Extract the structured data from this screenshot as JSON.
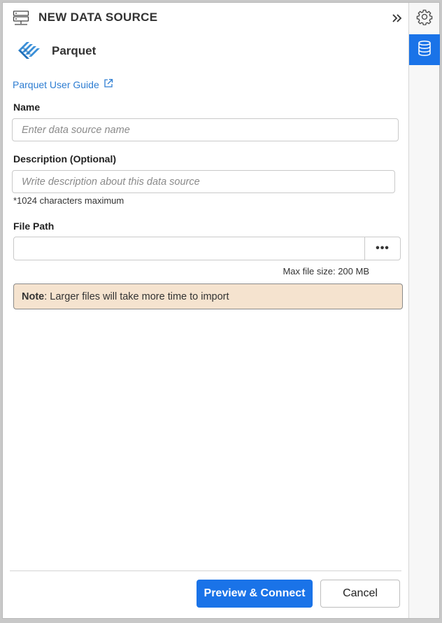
{
  "header": {
    "title": "NEW DATA SOURCE",
    "icon": "server-icon",
    "collapse_icon": "double-chevron-right-icon"
  },
  "source": {
    "name": "Parquet",
    "logo": "parquet-logo"
  },
  "guide": {
    "label": "Parquet User Guide",
    "icon": "external-link-icon"
  },
  "form": {
    "name_label": "Name",
    "name_placeholder": "Enter data source name",
    "name_value": "",
    "description_label": "Description (Optional)",
    "description_placeholder": "Write description about this data source",
    "description_value": "",
    "description_hint": "*1024 characters maximum",
    "filepath_label": "File Path",
    "filepath_value": "",
    "browse_label": "•••",
    "max_size": "Max file size: 200 MB"
  },
  "note": {
    "bold": "Note",
    "text": ": Larger files will take more time to import"
  },
  "footer": {
    "primary_label": "Preview & Connect",
    "secondary_label": "Cancel"
  },
  "rail": {
    "items": [
      {
        "icon": "gear-icon",
        "active": false
      },
      {
        "icon": "database-icon",
        "active": true
      }
    ]
  },
  "colors": {
    "accent": "#1a73e8",
    "link": "#2d7dd2",
    "note_bg": "#f5e3cf"
  }
}
